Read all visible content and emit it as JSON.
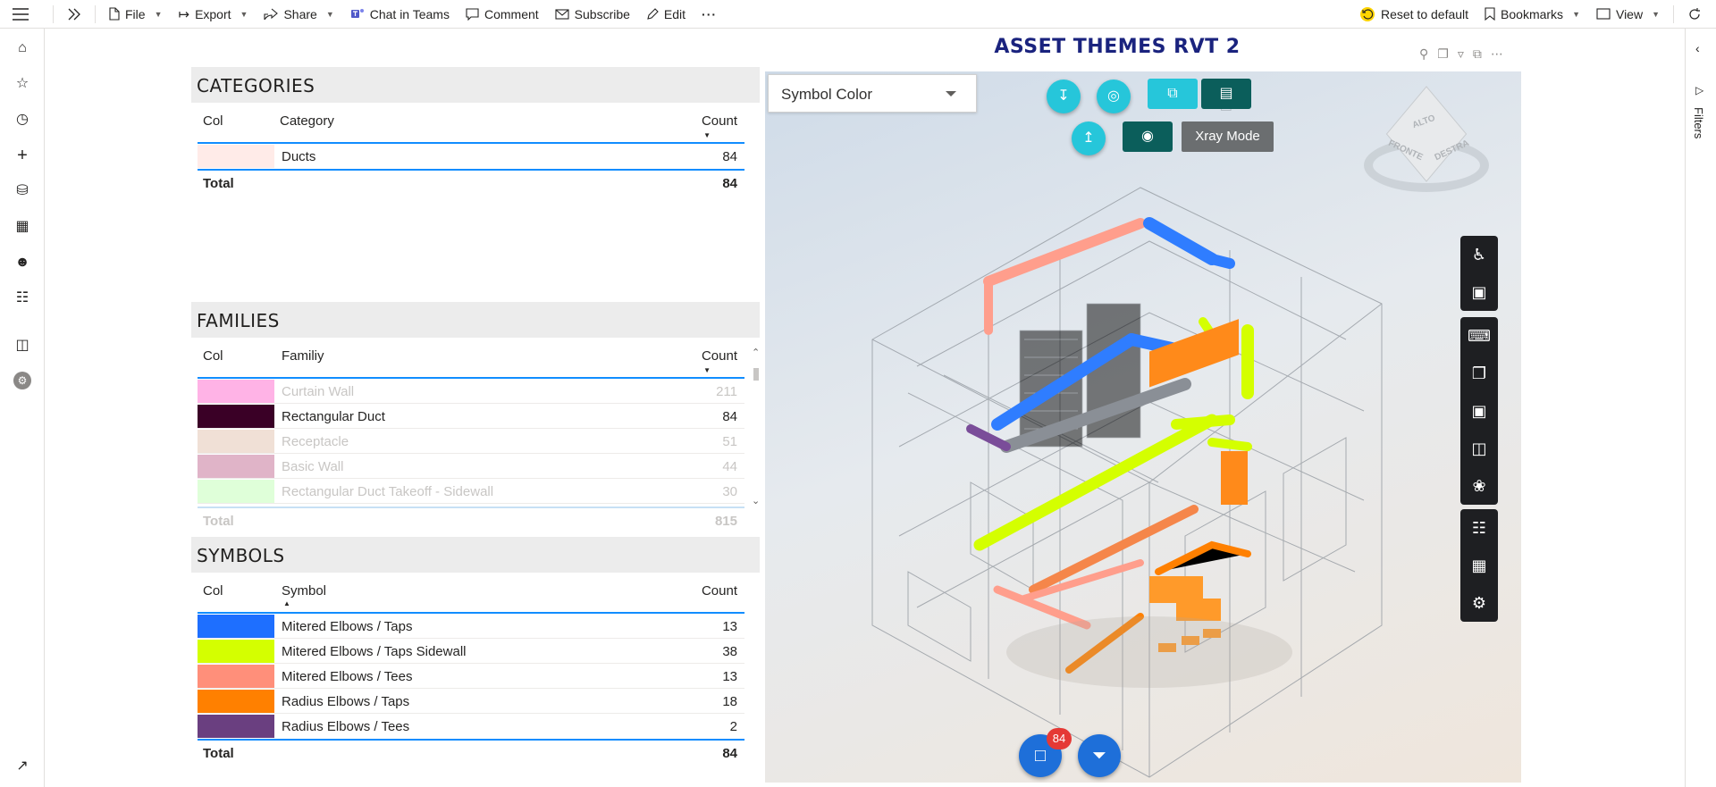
{
  "toolbar": {
    "file": "File",
    "export": "Export",
    "share": "Share",
    "chat_in_teams": "Chat in Teams",
    "comment": "Comment",
    "subscribe": "Subscribe",
    "edit": "Edit",
    "more": "···",
    "reset": "Reset to default",
    "bookmarks": "Bookmarks",
    "view": "View"
  },
  "report": {
    "title": "ASSET THEMES RVT 2"
  },
  "filters_pane": {
    "label": "Filters"
  },
  "categories": {
    "title": "CATEGORIES",
    "col_header": "Col",
    "name_header": "Category",
    "count_header": "Count",
    "rows": [
      {
        "name": "Ducts",
        "count": "84",
        "color": "#ffebe8"
      }
    ],
    "total_label": "Total",
    "total": "84"
  },
  "families": {
    "title": "FAMILIES",
    "col_header": "Col",
    "name_header": "Familiy",
    "count_header": "Count",
    "rows": [
      {
        "name": "Curtain Wall",
        "count": "211",
        "color": "#ffb3e6"
      },
      {
        "name": "Rectangular Duct",
        "count": "84",
        "color": "#3a0026"
      },
      {
        "name": "Receptacle",
        "count": "51",
        "color": "#f0e0d6"
      },
      {
        "name": "Basic Wall",
        "count": "44",
        "color": "#e0b4c8"
      },
      {
        "name": "Rectangular Duct Takeoff - Sidewall",
        "count": "30",
        "color": "#dfffd9"
      }
    ],
    "total_label": "Total",
    "total": "815"
  },
  "symbols": {
    "title": "SYMBOLS",
    "col_header": "Col",
    "name_header": "Symbol",
    "count_header": "Count",
    "rows": [
      {
        "name": "Mitered Elbows / Taps",
        "count": "13",
        "color": "#1e6fff"
      },
      {
        "name": "Mitered Elbows / Taps Sidewall",
        "count": "38",
        "color": "#d4ff00"
      },
      {
        "name": "Mitered Elbows / Tees",
        "count": "13",
        "color": "#ff8f7a"
      },
      {
        "name": "Radius Elbows / Taps",
        "count": "18",
        "color": "#ff8000"
      },
      {
        "name": "Radius Elbows / Tees",
        "count": "2",
        "color": "#6a3f80"
      }
    ],
    "total_label": "Total",
    "total": "84"
  },
  "viewer": {
    "dropdown_value": "Symbol Color",
    "xray_tooltip": "Xray Mode",
    "selection_badge": "84",
    "cube_labels": [
      "ALTO",
      "FRONTE",
      "DESTRA"
    ]
  }
}
